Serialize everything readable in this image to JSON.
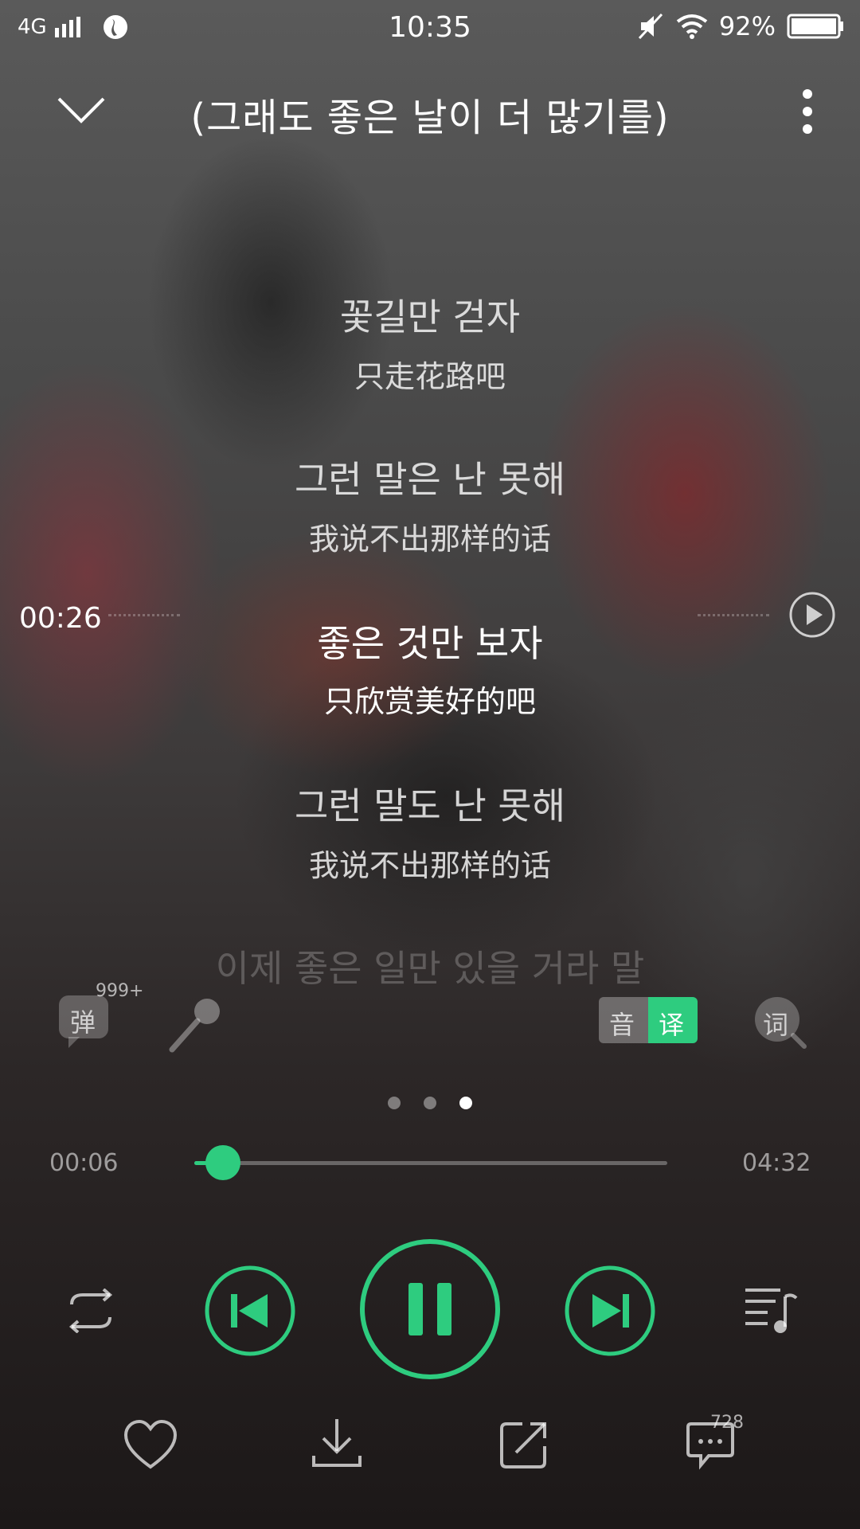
{
  "status_bar": {
    "network": "4G",
    "time": "10:35",
    "battery": "92%"
  },
  "header": {
    "title": "(그래도 좋은 날이 더 많기를)"
  },
  "lyrics": [
    {
      "ko": "꽃길만 걷자",
      "zh": "只走花路吧"
    },
    {
      "ko": "그런 말은 난 못해",
      "zh": "我说不出那样的话"
    },
    {
      "ko": "좋은 것만 보자",
      "zh": "只欣赏美好的吧"
    },
    {
      "ko": "그런 말도 난 못해",
      "zh": "我说不出那样的话"
    },
    {
      "ko": "이제 좋은 일만 있을 거라 말"
    }
  ],
  "lyric_seek": {
    "time": "00:26"
  },
  "tools": {
    "danmaku_label": "弹",
    "danmaku_count": "999+",
    "yin_label": "音",
    "yi_label": "译",
    "ci_label": "词"
  },
  "pager": {
    "count": 3,
    "active": 2
  },
  "progress": {
    "elapsed": "00:06",
    "duration": "04:32",
    "fraction": 0.06
  },
  "bottom_actions": {
    "comment_count": "728"
  },
  "colors": {
    "accent": "#2ecc7f"
  }
}
